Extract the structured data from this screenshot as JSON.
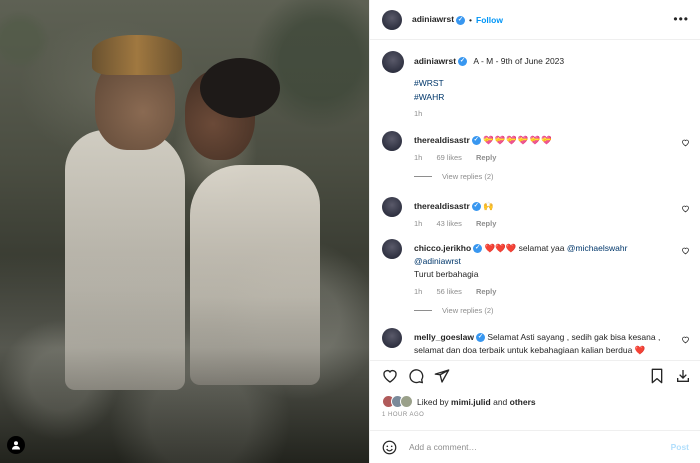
{
  "header": {
    "username": "adiniawrst",
    "separator": "•",
    "follow_label": "Follow",
    "more_icon": "more-horizontal-icon"
  },
  "caption": {
    "username": "adiniawrst",
    "text": "A - M - 9th of June 2023",
    "hashtags": [
      "#WRST",
      "#WAHR"
    ],
    "time": "1h"
  },
  "comments": [
    {
      "username": "therealdisastr",
      "text": "💝💝💝💝💝💝",
      "time": "1h",
      "likes": "69 likes",
      "reply_label": "Reply",
      "view_replies": "View replies (2)"
    },
    {
      "username": "therealdisastr",
      "text": "🙌",
      "time": "1h",
      "likes": "43 likes",
      "reply_label": "Reply"
    },
    {
      "username": "chicco.jerikho",
      "text_prefix": "❤️❤️❤️ selamat yaa ",
      "mention_1": "@michaelswahr",
      "mention_2": "@adiniawrst",
      "text_line2": "Turut berbahagia",
      "time": "1h",
      "likes": "56 likes",
      "reply_label": "Reply",
      "view_replies": "View replies (2)"
    },
    {
      "username": "melly_goeslaw",
      "text": "Selamat Asti sayang , sedih gak bisa kesana , selamat dan doa terbaik untuk kebahagiaan kalian berdua ❤️"
    }
  ],
  "liked_by": {
    "prefix": "Liked by",
    "user": "mimi.julid",
    "conjunction": "and",
    "others": "others"
  },
  "post_time": "1 HOUR AGO",
  "add_comment": {
    "placeholder": "Add a comment…",
    "post_label": "Post"
  },
  "colors": {
    "accent": "#0095f6",
    "verified": "#3897f0",
    "muted": "#8e8e8e",
    "link": "#00376b"
  }
}
